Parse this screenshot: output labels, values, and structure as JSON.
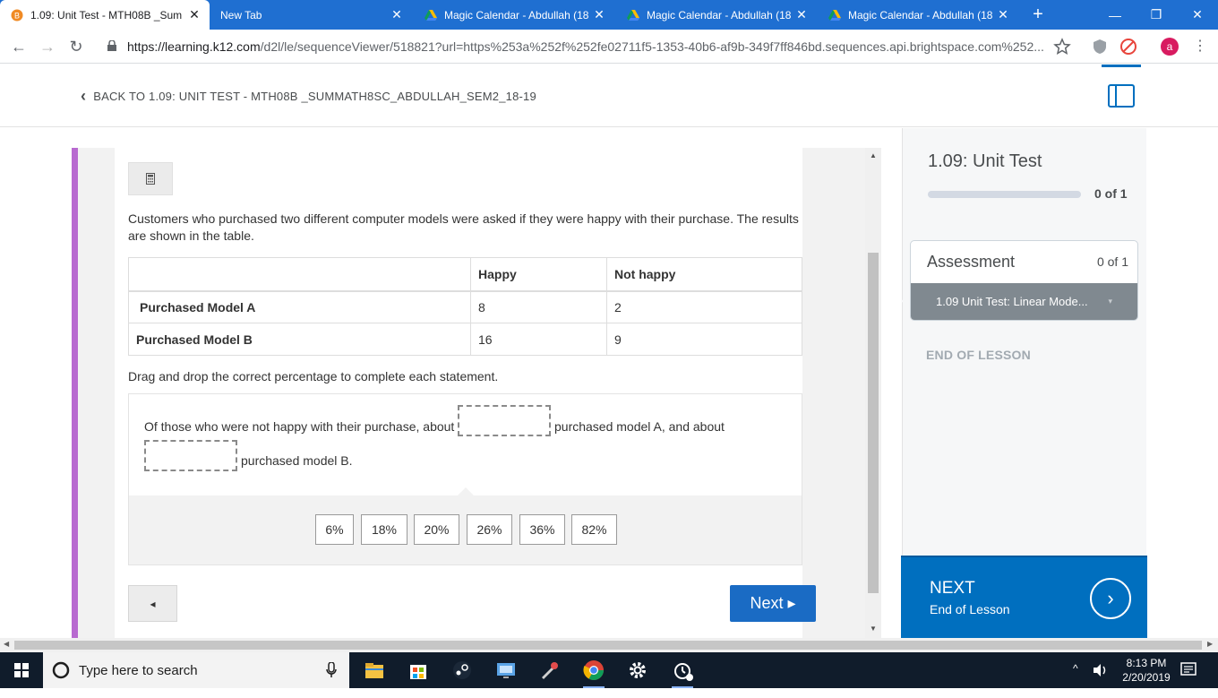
{
  "browser": {
    "tabs": [
      {
        "title": "1.09: Unit Test - MTH08B _Sum",
        "active": true
      },
      {
        "title": "New Tab",
        "active": false
      },
      {
        "title": "Magic Calendar - Abdullah (18",
        "active": false
      },
      {
        "title": "Magic Calendar - Abdullah (18",
        "active": false
      },
      {
        "title": "Magic Calendar - Abdullah (18",
        "active": false
      }
    ],
    "url_host": "https://learning.k12.com",
    "url_path": "/d2l/le/sequenceViewer/518821?url=https%253a%252f%252fe02711f5-1353-40b6-af9b-349f7ff846bd.sequences.api.brightspace.com%252...",
    "profile_initial": "a"
  },
  "header": {
    "back_label": "BACK TO 1.09: UNIT TEST - MTH08B _SUMMATH8SC_ABDULLAH_SEM2_18-19"
  },
  "question": {
    "prompt": "Customers who purchased two different computer models were asked if they were happy with their purchase. The results are shown in the table.",
    "table": {
      "headers": [
        "",
        "Happy",
        "Not happy"
      ],
      "rows": [
        [
          "Purchased Model A",
          "8",
          "2"
        ],
        [
          "Purchased Model B",
          "16",
          "9"
        ]
      ]
    },
    "instruction": "Drag and drop the correct percentage to complete each statement.",
    "statement": {
      "part1": "Of those who were not happy with their purchase, about",
      "part2": "purchased model A, and about",
      "part3": "purchased model B."
    },
    "choices": [
      "6%",
      "18%",
      "20%",
      "26%",
      "36%",
      "82%"
    ]
  },
  "nav": {
    "prev_label": "◂",
    "next_label": "Next ▸"
  },
  "sidebar": {
    "title": "1.09: Unit Test",
    "progress_text": "0 of 1",
    "progress_fraction": 0,
    "assessment": {
      "heading": "Assessment",
      "count": "0 of 1",
      "item": "1.09 Unit Test: Linear Mode..."
    },
    "end_label": "END OF LESSON",
    "next": {
      "label": "NEXT",
      "sub": "End of Lesson"
    }
  },
  "taskbar": {
    "search_placeholder": "Type here to search",
    "time": "8:13 PM",
    "date": "2/20/2019"
  },
  "colors": {
    "accent": "#006fbf",
    "chrome_bar": "#1f6fd1",
    "purple_strip": "#b86ad0"
  }
}
